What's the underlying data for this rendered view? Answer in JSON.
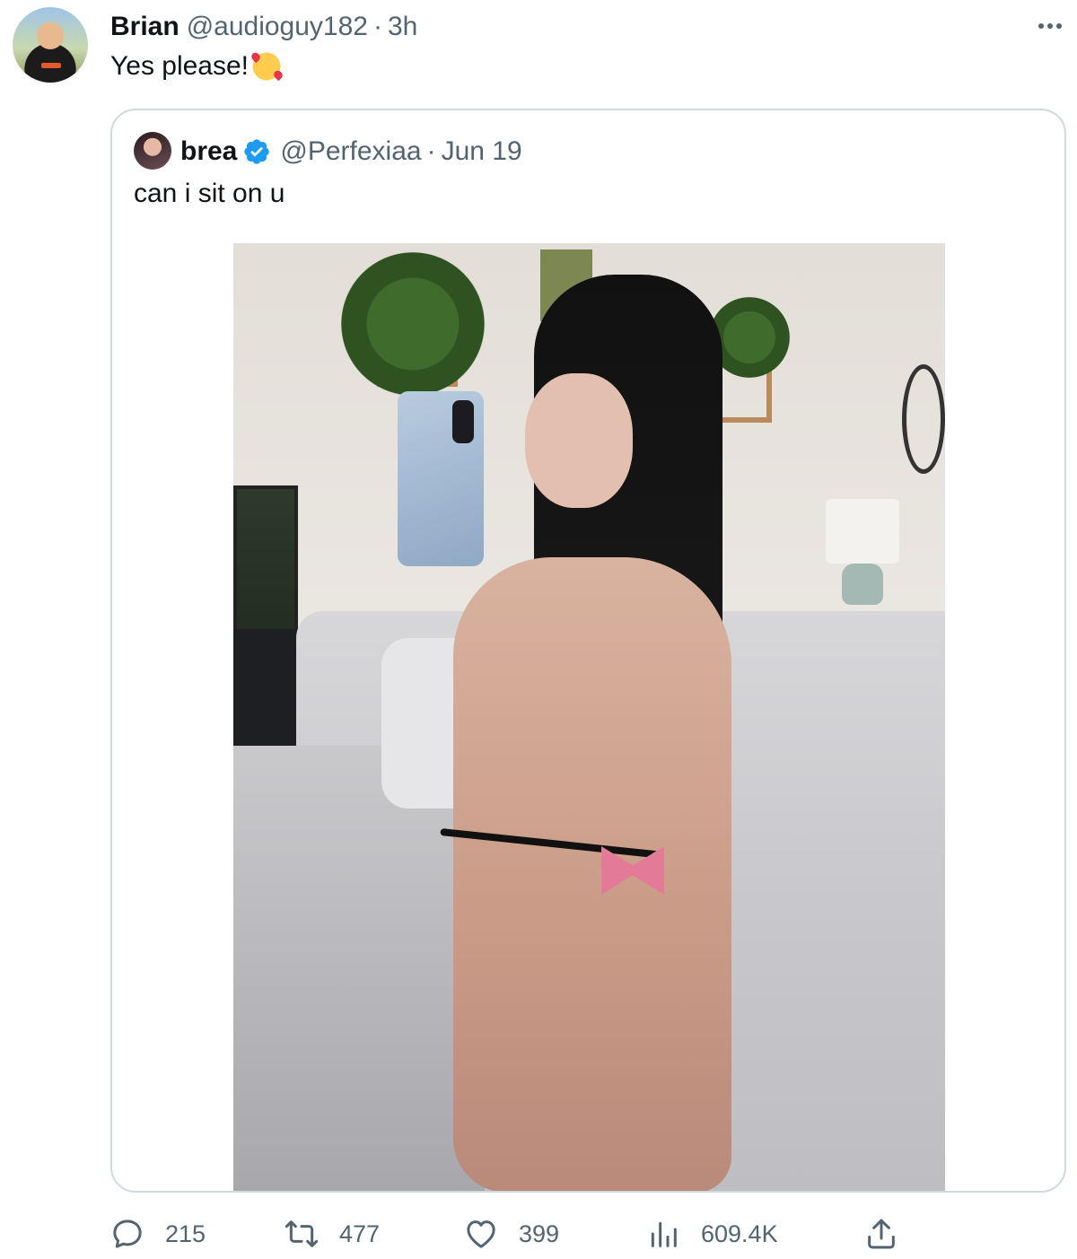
{
  "tweet": {
    "display_name": "Brian",
    "handle": "@audioguy182",
    "separator": "·",
    "time": "3h",
    "text": "Yes please!",
    "emoji_icon": "smiling-face-with-hearts-icon"
  },
  "quoted_tweet": {
    "display_name": "brea",
    "verified": true,
    "handle": "@Perfexiaa",
    "separator": "·",
    "date": "Jun 19",
    "text": "can i sit on u",
    "media_icon": "photo"
  },
  "actions": {
    "replies": "215",
    "retweets": "477",
    "likes": "399",
    "views": "609.4K"
  },
  "colors": {
    "text_primary": "#0f1419",
    "text_secondary": "#536471",
    "verified_blue": "#1d9bf0",
    "card_border": "#cfd9de"
  }
}
